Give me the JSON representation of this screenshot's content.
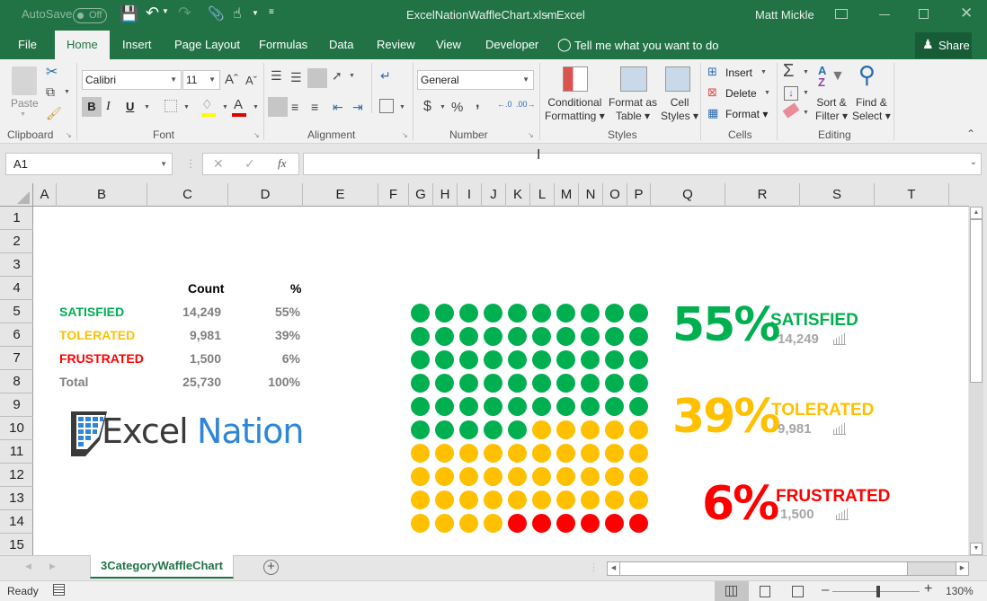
{
  "titlebar": {
    "autosave_label": "AutoSave",
    "autosave_state": "Off",
    "filename": "ExcelNationWaffleChart.xlsm",
    "separator": "-",
    "app": "Excel",
    "user": "Matt Mickle"
  },
  "tabs": [
    "File",
    "Home",
    "Insert",
    "Page Layout",
    "Formulas",
    "Data",
    "Review",
    "View",
    "Developer"
  ],
  "active_tab": "Home",
  "tell_me": "Tell me what you want to do",
  "share": "Share",
  "ribbon": {
    "clipboard": {
      "label": "Clipboard",
      "paste": "Paste"
    },
    "font": {
      "label": "Font",
      "name": "Calibri",
      "size": "11",
      "bold": "B",
      "italic": "I",
      "underline": "U"
    },
    "alignment": {
      "label": "Alignment"
    },
    "number": {
      "label": "Number",
      "format": "General",
      "currency": "$",
      "percent": "%",
      "comma": ","
    },
    "styles": {
      "label": "Styles",
      "conditional_1": "Conditional",
      "conditional_2": "Formatting",
      "format_table_1": "Format as",
      "format_table_2": "Table",
      "cell_styles_1": "Cell",
      "cell_styles_2": "Styles"
    },
    "cells": {
      "label": "Cells",
      "insert": "Insert",
      "delete": "Delete",
      "format": "Format"
    },
    "editing": {
      "label": "Editing",
      "sort_1": "Sort &",
      "sort_2": "Filter",
      "find_1": "Find &",
      "find_2": "Select"
    }
  },
  "formula_bar": {
    "name_box": "A1",
    "fx": "fx",
    "formula": ""
  },
  "columns": [
    "A",
    "B",
    "C",
    "D",
    "E",
    "F",
    "G",
    "H",
    "I",
    "J",
    "K",
    "L",
    "M",
    "N",
    "O",
    "P",
    "Q",
    "R",
    "S",
    "T"
  ],
  "rows": [
    "1",
    "2",
    "3",
    "4",
    "5",
    "6",
    "7",
    "8",
    "9",
    "10",
    "11",
    "12",
    "13",
    "14",
    "15"
  ],
  "table": {
    "headers": {
      "count": "Count",
      "pct": "%"
    },
    "rows": [
      {
        "label": "SATISFIED",
        "count": "14,249",
        "pct": "55%",
        "color": "#00b050"
      },
      {
        "label": "TOLERATED",
        "count": "9,981",
        "pct": "39%",
        "color": "#ffc000"
      },
      {
        "label": "FRUSTRATED",
        "count": "1,500",
        "pct": "6%",
        "color": "#ff0000"
      },
      {
        "label": "Total",
        "count": "25,730",
        "pct": "100%",
        "color": "#7f7f7f"
      }
    ]
  },
  "logo": {
    "part1": "Excel",
    "part2": "Nation"
  },
  "chart_data": {
    "type": "waffle",
    "grid": [
      10,
      10
    ],
    "categories": [
      "SATISFIED",
      "TOLERATED",
      "FRUSTRATED"
    ],
    "values": [
      55,
      39,
      6
    ],
    "counts": [
      "14,249",
      "9,981",
      "1,500"
    ],
    "colors": [
      "#00b050",
      "#ffc000",
      "#ff0000"
    ]
  },
  "kpis": [
    {
      "pct": "55%",
      "label": "SATISFIED",
      "count": "14,249",
      "color": "#00b050"
    },
    {
      "pct": "39%",
      "label": "TOLERATED",
      "count": "9,981",
      "color": "#ffc000"
    },
    {
      "pct": "6%",
      "label": "FRUSTRATED",
      "count": "1,500",
      "color": "#ff0000"
    }
  ],
  "sheet_tab": "3CategoryWaffleChart",
  "status": {
    "ready": "Ready",
    "zoom": "130%"
  }
}
